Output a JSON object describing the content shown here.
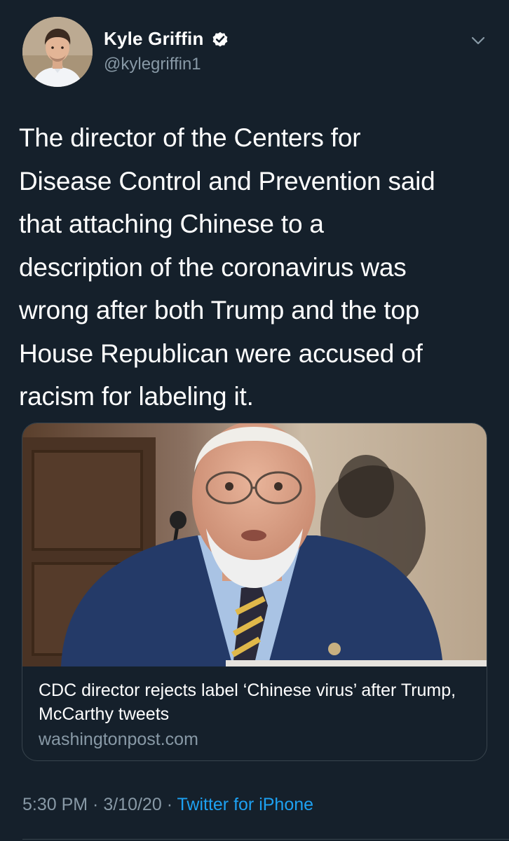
{
  "author": {
    "display_name": "Kyle Griffin",
    "handle": "@kylegriffin1",
    "verified": true,
    "avatar_icon": "avatar-photo",
    "verified_icon": "verified-badge-icon"
  },
  "menu": {
    "icon": "chevron-down-icon"
  },
  "tweet": {
    "text": "The director of the Centers for\nDisease Control and Prevention said\nthat attaching Chinese to a\ndescription of the coronavirus was\nwrong after both Trump and the top\nHouse Republican were accused of\nracism for labeling it."
  },
  "card": {
    "title": "CDC director rejects label ‘Chinese virus’ after Trump, McCarthy tweets",
    "domain": "washingtonpost.com"
  },
  "meta": {
    "time": "5:30 PM",
    "separator": " · ",
    "date": "3/10/20",
    "source": "Twitter for iPhone"
  },
  "colors": {
    "background": "#15202b",
    "secondary_text": "#8899a6",
    "link": "#1da1f2",
    "border": "#38444d"
  }
}
